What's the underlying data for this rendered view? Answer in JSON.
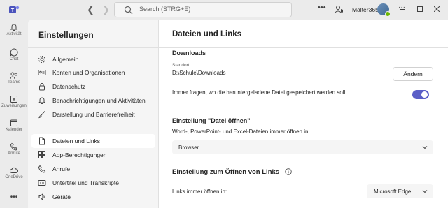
{
  "titlebar": {
    "back_icon": "chevron-left-icon",
    "forward_icon": "chevron-right-icon",
    "search_placeholder": "Search (STRG+E)",
    "more": "•••",
    "org": "Malter365"
  },
  "rail": {
    "items": [
      {
        "label": "Aktivität",
        "icon": "bell-icon"
      },
      {
        "label": "Chat",
        "icon": "chat-icon"
      },
      {
        "label": "Teams",
        "icon": "teams-icon"
      },
      {
        "label": "Zuweisungen",
        "icon": "assignments-icon"
      },
      {
        "label": "Kalender",
        "icon": "calendar-icon"
      },
      {
        "label": "Anrufe",
        "icon": "phone-icon"
      },
      {
        "label": "OneDrive",
        "icon": "cloud-icon"
      },
      {
        "label": "•••",
        "icon": "more-icon"
      }
    ]
  },
  "settings": {
    "title": "Einstellungen",
    "items": [
      {
        "label": "Allgemein",
        "icon": "gear-icon"
      },
      {
        "label": "Konten und Organisationen",
        "icon": "id-card-icon"
      },
      {
        "label": "Datenschutz",
        "icon": "lock-icon"
      },
      {
        "label": "Benachrichtigungen und Aktivitäten",
        "icon": "bell-icon"
      },
      {
        "label": "Darstellung und Barrierefreiheit",
        "icon": "brush-icon"
      },
      {
        "label": "Dateien und Links",
        "icon": "document-icon"
      },
      {
        "label": "App-Berechtigungen",
        "icon": "grid-icon"
      },
      {
        "label": "Anrufe",
        "icon": "phone-icon"
      },
      {
        "label": "Untertitel und Transkripte",
        "icon": "captions-icon"
      },
      {
        "label": "Geräte",
        "icon": "speaker-icon"
      }
    ]
  },
  "main": {
    "title": "Dateien und Links",
    "downloads": {
      "heading": "Downloads",
      "location_label": "Standort",
      "location_value": "D:\\Schule\\Downloads",
      "change_button": "Ändern",
      "ask_label": "Immer fragen, wo die heruntergeladene Datei gespeichert werden soll",
      "ask_enabled": true
    },
    "open_files": {
      "heading": "Einstellung \"Datei öffnen\"",
      "description": "Word-, PowerPoint- und Excel-Dateien immer öffnen in:",
      "selected": "Browser"
    },
    "open_links": {
      "heading": "Einstellung zum Öffnen von Links",
      "description": "Links immer öffnen in:",
      "selected": "Microsoft Edge"
    }
  },
  "colors": {
    "accent": "#5b5fc7",
    "status_available": "#6bb700"
  }
}
